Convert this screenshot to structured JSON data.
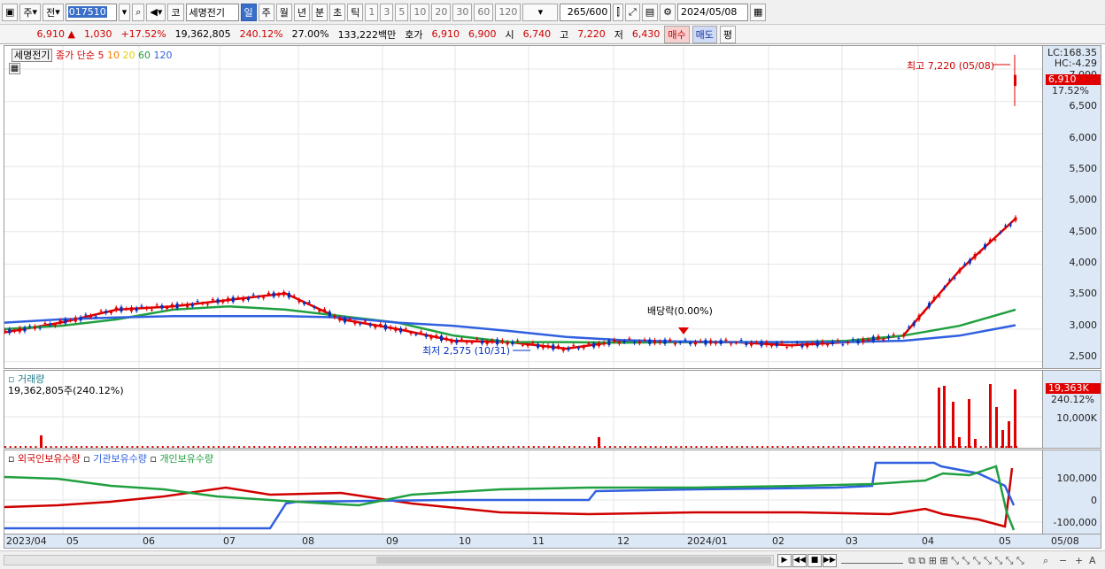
{
  "toolbar": {
    "market": "주",
    "prev_label": "전",
    "code": "017510",
    "stock_name": "세명전기",
    "market_tag": "코",
    "periods": [
      "일",
      "주",
      "월",
      "년",
      "분",
      "초",
      "틱"
    ],
    "active_period": "일",
    "intervals": [
      "1",
      "3",
      "5",
      "10",
      "20",
      "30",
      "60",
      "120"
    ],
    "count": "265",
    "count_total": "/600",
    "date": "2024/05/08"
  },
  "quote": {
    "price": "6,910",
    "change": "1,030",
    "change_pct": "+17.52%",
    "volume": "19,362,805",
    "volume_ratio": "240.12%",
    "turnover": "27.00%",
    "amount": "133,222백만",
    "ask_label": "호가",
    "ask": "6,910",
    "bid": "6,900",
    "open_label": "시",
    "open": "6,740",
    "high_label": "고",
    "high": "7,220",
    "low_label": "저",
    "low": "6,430",
    "buy": "매수",
    "sell": "매도",
    "eval": "평"
  },
  "price_panel": {
    "name_tag": "세명전기",
    "ma_label": "종가 단순",
    "ma_periods": [
      "5",
      "10",
      "20",
      "60",
      "120"
    ],
    "lc": "LC:168.35",
    "hc": "HC:-4.29",
    "cur_price": "6,910",
    "cur_pct": "17.52%",
    "high_annot": "최고 7,220 (05/08)",
    "low_annot": "최저 2,575 (10/31)",
    "div_annot": "배당락(0.00%)",
    "y_labels": [
      "7,000",
      "6,500",
      "6,000",
      "5,500",
      "5,000",
      "4,500",
      "4,000",
      "3,500",
      "3,000",
      "2,500"
    ]
  },
  "volume_panel": {
    "title": "거래량",
    "value": "19,362,805주(240.12%)",
    "tag": "19,363K",
    "pct": "240.12%",
    "y_label": "10,000K"
  },
  "holding_panel": {
    "legend": [
      "외국인보유수량",
      "기관보유수량",
      "개인보유수량"
    ],
    "y_labels": [
      "100,000",
      "0",
      "-100,000"
    ]
  },
  "x_labels": [
    "2023/04",
    "05",
    "06",
    "07",
    "08",
    "09",
    "10",
    "11",
    "12",
    "2024/01",
    "02",
    "03",
    "04",
    "05",
    "05/08"
  ],
  "colors": {
    "up": "#e00000",
    "down": "#0030c0",
    "ma5": "#e00000",
    "ma10": "#f08000",
    "ma20": "#f0e000",
    "ma60": "#20a040",
    "ma120": "#3060e0"
  },
  "chart_data": {
    "type": "line",
    "title": "",
    "series": [
      {
        "name": "5",
        "values": [
          2950,
          3100,
          3300,
          3350,
          3450,
          3550,
          3150,
          3000,
          2820,
          2800,
          2700,
          2820,
          2800,
          2800,
          2750,
          2800,
          2900,
          3900,
          4700
        ]
      },
      {
        "name": "60",
        "values": [
          3000,
          3050,
          3150,
          3300,
          3350,
          3300,
          3200,
          3100,
          2900,
          2800,
          2800,
          2790,
          2800,
          2800,
          2800,
          2820,
          2900,
          3050,
          3300
        ]
      },
      {
        "name": "120",
        "values": [
          3100,
          3150,
          3180,
          3200,
          3200,
          3200,
          3180,
          3100,
          3050,
          2970,
          2880,
          2830,
          2810,
          2800,
          2800,
          2800,
          2820,
          2900,
          3060
        ]
      }
    ],
    "ylim": [
      2400,
      7300
    ]
  }
}
